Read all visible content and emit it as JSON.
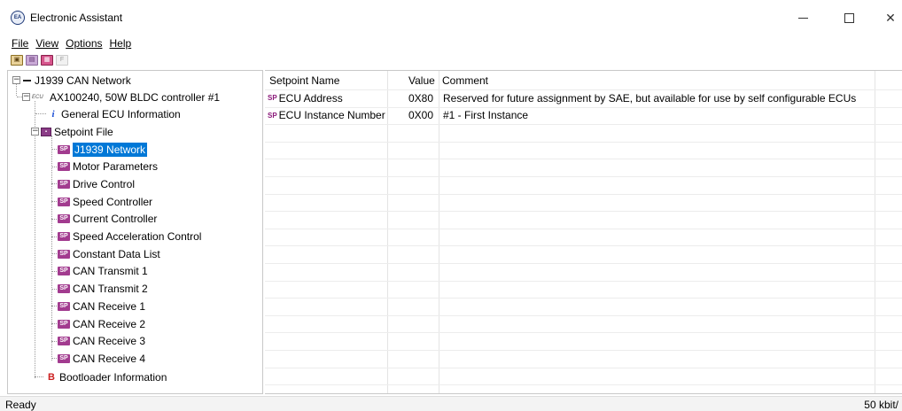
{
  "window": {
    "title": "Electronic Assistant",
    "app_icon": "app-logo-icon"
  },
  "menu": [
    "File",
    "View",
    "Options",
    "Help"
  ],
  "toolbar": {
    "buttons": [
      "open-ecu-icon",
      "setpoint-icon",
      "save-icon"
    ],
    "f_label": "F"
  },
  "tree": {
    "root": "J1939 CAN Network",
    "ecu_tag": "ECU",
    "ecu": "AX100240, 50W BLDC controller #1",
    "general_info": "General ECU Information",
    "setpoint_file": "Setpoint File",
    "sp_tag": "SP",
    "setpoints": [
      "J1939 Network",
      "Motor Parameters",
      "Drive Control",
      "Speed Controller",
      "Current Controller",
      "Speed Acceleration Control",
      "Constant Data List",
      "CAN Transmit 1",
      "CAN Transmit 2",
      "CAN Receive 1",
      "CAN Receive 2",
      "CAN Receive 3",
      "CAN Receive 4"
    ],
    "selected_index": 0,
    "bootloader": "Bootloader Information"
  },
  "grid": {
    "headers": {
      "name": "Setpoint Name",
      "value": "Value",
      "comment": "Comment"
    },
    "sp_tag": "SP",
    "rows": [
      {
        "name": "ECU Address",
        "value": "0X80",
        "comment": "Reserved for future assignment by SAE, but available for use by self configurable ECUs"
      },
      {
        "name": "ECU Instance Number",
        "value": "0X00",
        "comment": "#1 - First Instance"
      }
    ]
  },
  "status": {
    "left": "Ready",
    "right": "50 kbit/"
  },
  "colors": {
    "selection": "#0078d7",
    "setpoint_icon": "#a23b8f",
    "info_icon": "#1b4fd6",
    "bootloader_icon": "#cc1f1f"
  }
}
